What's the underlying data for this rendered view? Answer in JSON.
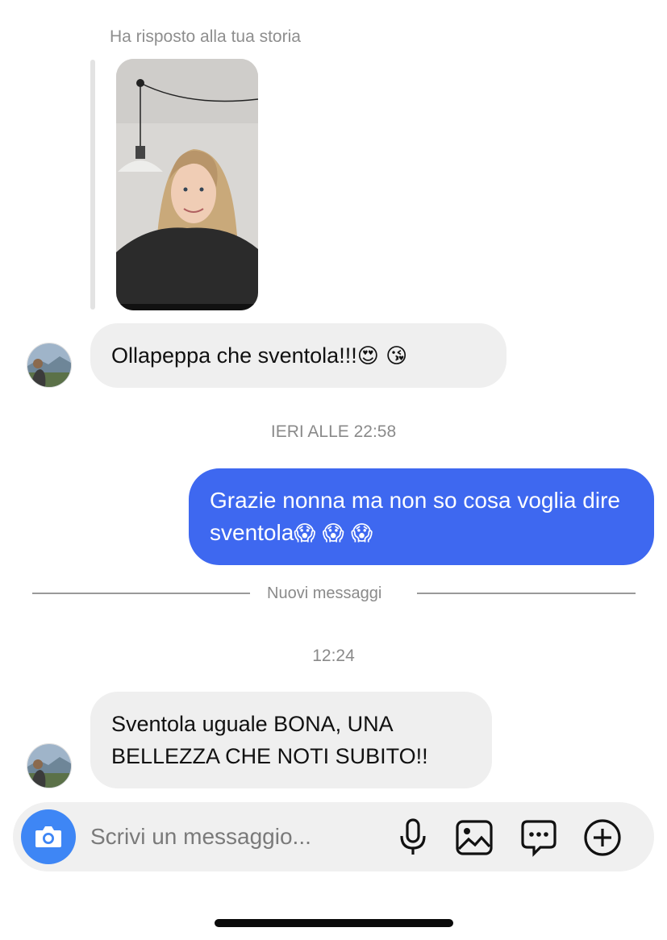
{
  "thread": {
    "reply_label": "Ha risposto alla tua storia",
    "messages": [
      {
        "text": "Ollapeppa  che sventola!!!",
        "emojis": "😍 😘"
      },
      {
        "text": "Grazie nonna ma non so cosa voglia dire sventola",
        "emojis": "😱 😱 😱"
      },
      {
        "line1": "Sventola uguale BONA, UNA",
        "line2": "BELLEZZA CHE NOTI SUBITO!!"
      }
    ],
    "timestamp_1": "IERI ALLE 22:58",
    "new_messages_label": "Nuovi messaggi",
    "timestamp_2": "12:24"
  },
  "composer": {
    "placeholder": "Scrivi un messaggio...",
    "icons": [
      "camera-icon",
      "microphone-icon",
      "gallery-icon",
      "sticker-icon",
      "plus-icon"
    ]
  },
  "colors": {
    "outgoing_bubble": "#3e68f0",
    "incoming_bubble": "#efefef",
    "camera_button": "#3e86f5"
  }
}
